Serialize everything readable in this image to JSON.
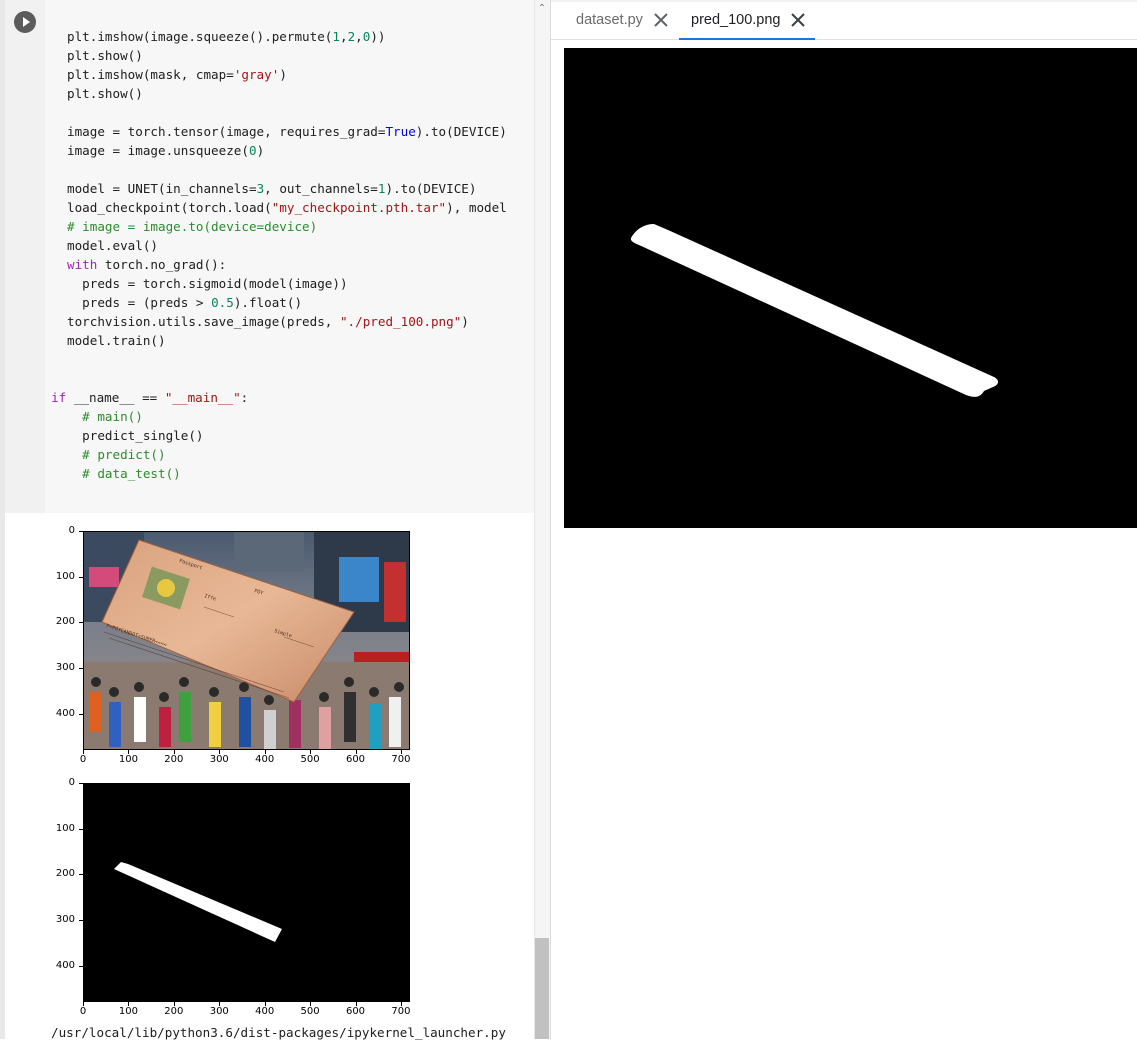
{
  "notebook": {
    "code_lines": [
      {
        "parts": [
          {
            "t": "plt.imshow(image.squeeze().permute("
          },
          {
            "t": "1",
            "c": "num"
          },
          {
            "t": ","
          },
          {
            "t": "2",
            "c": "num"
          },
          {
            "t": ","
          },
          {
            "t": "0",
            "c": "num"
          },
          {
            "t": "))"
          }
        ]
      },
      {
        "parts": [
          {
            "t": "plt.show()"
          }
        ]
      },
      {
        "parts": [
          {
            "t": "plt.imshow(mask, cmap="
          },
          {
            "t": "'gray'",
            "c": "str"
          },
          {
            "t": ")"
          }
        ]
      },
      {
        "parts": [
          {
            "t": "plt.show()"
          }
        ]
      },
      {
        "parts": []
      },
      {
        "parts": [
          {
            "t": "image = torch.tensor(image, requires_grad="
          },
          {
            "t": "True",
            "c": "bool"
          },
          {
            "t": ").to(DEVICE)"
          }
        ]
      },
      {
        "parts": [
          {
            "t": "image = image.unsqueeze("
          },
          {
            "t": "0",
            "c": "num"
          },
          {
            "t": ")"
          }
        ]
      },
      {
        "parts": []
      },
      {
        "parts": [
          {
            "t": "model = UNET(in_channels="
          },
          {
            "t": "3",
            "c": "num"
          },
          {
            "t": ", out_channels="
          },
          {
            "t": "1",
            "c": "num"
          },
          {
            "t": ").to(DEVICE)"
          }
        ]
      },
      {
        "parts": [
          {
            "t": "load_checkpoint(torch.load("
          },
          {
            "t": "\"my_checkpoint.pth.tar\"",
            "c": "str"
          },
          {
            "t": "), model"
          }
        ]
      },
      {
        "parts": [
          {
            "t": "# image = image.to(device=device)",
            "c": "cmt"
          }
        ]
      },
      {
        "parts": [
          {
            "t": "model.eval()"
          }
        ]
      },
      {
        "parts": [
          {
            "t": "with",
            "c": "kw"
          },
          {
            "t": " torch.no_grad():"
          }
        ]
      },
      {
        "parts": [
          {
            "t": "  preds = torch.sigmoid(model(image))"
          }
        ]
      },
      {
        "parts": [
          {
            "t": "  preds = (preds > "
          },
          {
            "t": "0.5",
            "c": "num"
          },
          {
            "t": ").float()"
          }
        ]
      },
      {
        "parts": [
          {
            "t": "torchvision.utils.save_image(preds, "
          },
          {
            "t": "\"./pred_100.png\"",
            "c": "str"
          },
          {
            "t": ")"
          }
        ]
      },
      {
        "parts": [
          {
            "t": "model.train()"
          }
        ]
      },
      {
        "parts": []
      },
      {
        "parts": []
      },
      {
        "parts": [
          {
            "t": "if",
            "c": "kw"
          },
          {
            "t": " __name__ == "
          },
          {
            "t": "\"__main__\"",
            "c": "str"
          },
          {
            "t": ":"
          }
        ],
        "indent": -2
      },
      {
        "parts": [
          {
            "t": "  # main()",
            "c": "cmt"
          }
        ]
      },
      {
        "parts": [
          {
            "t": "  predict_single()"
          }
        ]
      },
      {
        "parts": [
          {
            "t": "  # predict()",
            "c": "cmt"
          }
        ]
      },
      {
        "parts": [
          {
            "t": "  # data_test()",
            "c": "cmt"
          }
        ]
      }
    ],
    "plot1": {
      "y_ticks": [
        "0",
        "100",
        "200",
        "300",
        "400"
      ],
      "x_ticks": [
        "0",
        "100",
        "200",
        "300",
        "400",
        "500",
        "600",
        "700"
      ],
      "card_texts": [
        "Passport",
        "POY",
        "P<POYCANDOT<SUBER<<<<",
        "Iffe",
        "Simple"
      ]
    },
    "plot2": {
      "y_ticks": [
        "0",
        "100",
        "200",
        "300",
        "400"
      ],
      "x_ticks": [
        "0",
        "100",
        "200",
        "300",
        "400",
        "500",
        "600",
        "700"
      ]
    },
    "stderr": "/usr/local/lib/python3.6/dist-packages/ipykernel_launcher.py"
  },
  "viewer": {
    "tabs": [
      {
        "label": "dataset.py",
        "active": false
      },
      {
        "label": "pred_100.png",
        "active": true
      }
    ]
  },
  "colors": {
    "accent": "#1a73e8",
    "code_bg": "#f7f7f7"
  },
  "icons": {
    "run": "play-circle-icon",
    "close": "close-icon"
  }
}
